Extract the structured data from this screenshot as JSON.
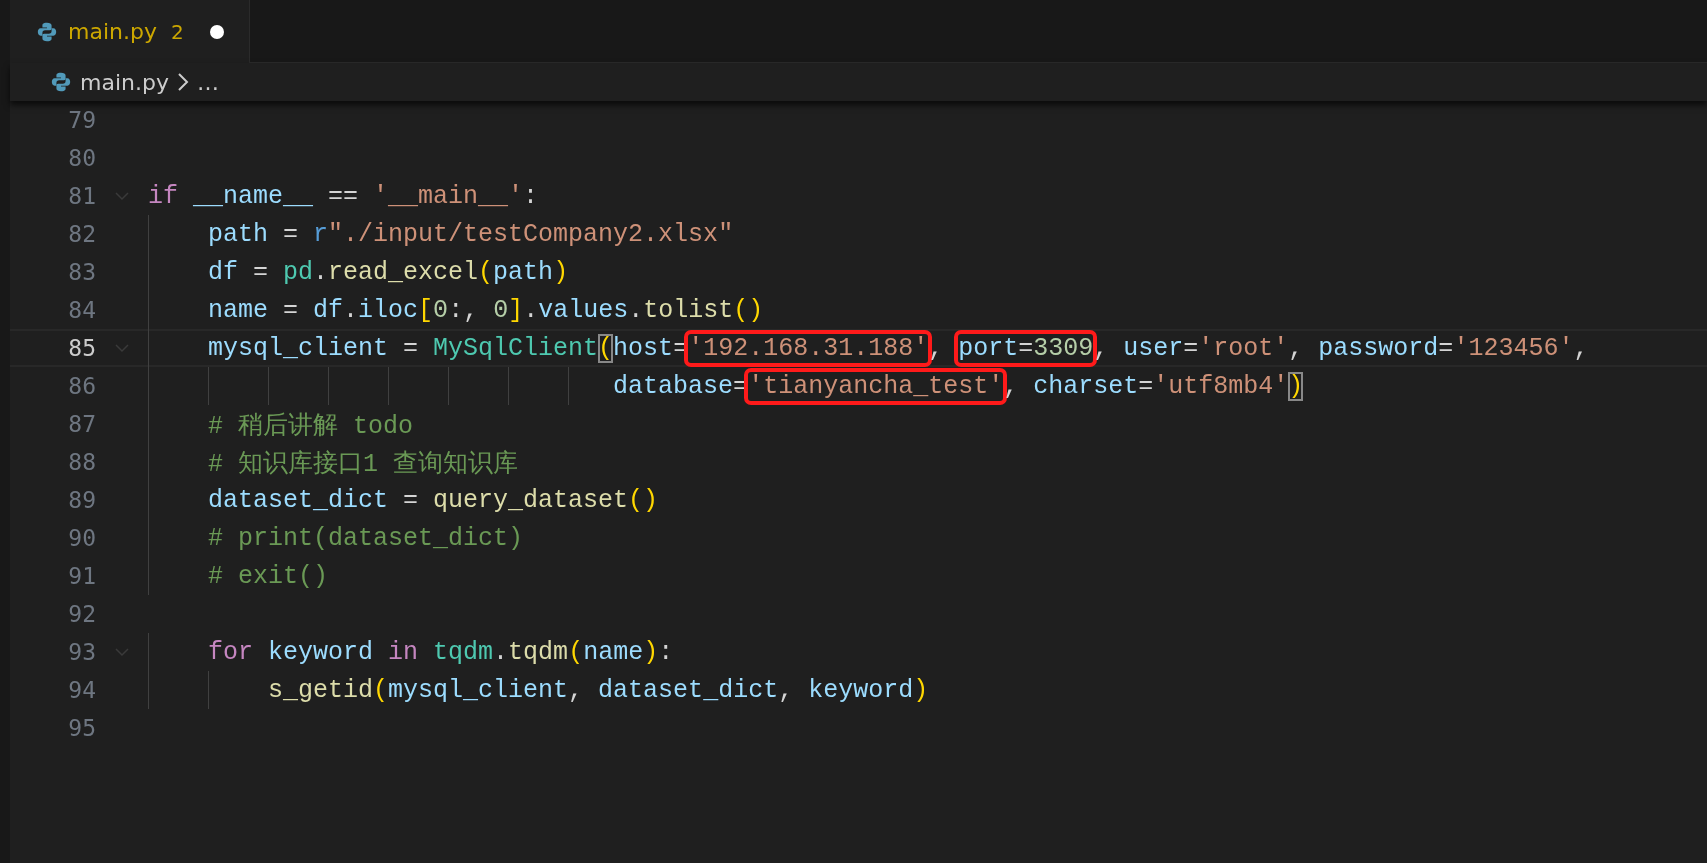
{
  "tabs": [
    {
      "label": "main.py",
      "problems": "2",
      "modified": true,
      "selected": true
    }
  ],
  "breadcrumb": {
    "file": "main.py",
    "more": "…"
  },
  "lines": [
    {
      "number": "79",
      "current": false,
      "foldable": false
    },
    {
      "number": "80",
      "current": false,
      "foldable": false
    },
    {
      "number": "81",
      "current": false,
      "foldable": true,
      "tokens": [
        {
          "kind": "keyword",
          "text": "if"
        },
        {
          "kind": "variable",
          "text": " __name__"
        },
        {
          "kind": "plain",
          "text": " == "
        },
        {
          "kind": "string",
          "text": "'__main__'"
        },
        {
          "kind": "plain",
          "text": ":"
        }
      ]
    },
    {
      "number": "82",
      "current": false,
      "foldable": false,
      "tokens": [
        {
          "kind": "variable",
          "text": "    path"
        },
        {
          "kind": "plain",
          "text": " = "
        },
        {
          "kind": "storage",
          "text": "r"
        },
        {
          "kind": "string",
          "text": "\"./input/testCompany2.xlsx\""
        }
      ]
    },
    {
      "number": "83",
      "current": false,
      "foldable": false,
      "tokens": [
        {
          "kind": "variable",
          "text": "    df"
        },
        {
          "kind": "plain",
          "text": " = "
        },
        {
          "kind": "class",
          "text": "pd"
        },
        {
          "kind": "plain",
          "text": "."
        },
        {
          "kind": "function",
          "text": "read_excel"
        },
        {
          "kind": "bracket",
          "text": "("
        },
        {
          "kind": "variable",
          "text": "path"
        },
        {
          "kind": "bracket",
          "text": ")"
        }
      ]
    },
    {
      "number": "84",
      "current": false,
      "foldable": false,
      "tokens": [
        {
          "kind": "variable",
          "text": "    name"
        },
        {
          "kind": "plain",
          "text": " = "
        },
        {
          "kind": "variable",
          "text": "df"
        },
        {
          "kind": "plain",
          "text": "."
        },
        {
          "kind": "variable",
          "text": "iloc"
        },
        {
          "kind": "bracket",
          "text": "["
        },
        {
          "kind": "number",
          "text": "0"
        },
        {
          "kind": "plain",
          "text": ":, "
        },
        {
          "kind": "number",
          "text": "0"
        },
        {
          "kind": "bracket",
          "text": "]"
        },
        {
          "kind": "plain",
          "text": "."
        },
        {
          "kind": "variable",
          "text": "values"
        },
        {
          "kind": "plain",
          "text": "."
        },
        {
          "kind": "function",
          "text": "tolist"
        },
        {
          "kind": "bracket",
          "text": "()"
        }
      ]
    },
    {
      "number": "85",
      "current": true,
      "foldable": true,
      "tokens": [
        {
          "kind": "variable",
          "text": "    mysql_client"
        },
        {
          "kind": "plain",
          "text": " = "
        },
        {
          "kind": "class",
          "text": "MySqlClient"
        },
        {
          "kind": "bracket-match",
          "text": "("
        },
        {
          "kind": "variable",
          "text": "host"
        },
        {
          "kind": "plain",
          "text": "="
        },
        {
          "kind": "annotation",
          "tokens": [
            {
              "kind": "string",
              "text": "'192.168.31.188'"
            }
          ]
        },
        {
          "kind": "plain",
          "text": ", "
        },
        {
          "kind": "annotation",
          "tokens": [
            {
              "kind": "variable",
              "text": "port"
            },
            {
              "kind": "plain",
              "text": "="
            },
            {
              "kind": "number",
              "text": "3309"
            }
          ]
        },
        {
          "kind": "plain",
          "text": ", "
        },
        {
          "kind": "variable",
          "text": "user"
        },
        {
          "kind": "plain",
          "text": "="
        },
        {
          "kind": "string",
          "text": "'root'"
        },
        {
          "kind": "plain",
          "text": ", "
        },
        {
          "kind": "variable",
          "text": "password"
        },
        {
          "kind": "plain",
          "text": "="
        },
        {
          "kind": "string",
          "text": "'123456'"
        },
        {
          "kind": "plain",
          "text": ","
        }
      ]
    },
    {
      "number": "86",
      "current": false,
      "foldable": false,
      "tokens": [
        {
          "kind": "variable",
          "text": "                               database"
        },
        {
          "kind": "plain",
          "text": "="
        },
        {
          "kind": "annotation",
          "tokens": [
            {
              "kind": "string",
              "text": "'tianyancha_test'"
            }
          ]
        },
        {
          "kind": "plain",
          "text": ", "
        },
        {
          "kind": "variable",
          "text": "charset"
        },
        {
          "kind": "plain",
          "text": "="
        },
        {
          "kind": "string",
          "text": "'utf8mb4'"
        },
        {
          "kind": "bracket-match",
          "text": ")"
        }
      ]
    },
    {
      "number": "87",
      "current": false,
      "foldable": false,
      "tokens": [
        {
          "kind": "comment",
          "text": "    # 稍后讲解 todo"
        }
      ]
    },
    {
      "number": "88",
      "current": false,
      "foldable": false,
      "tokens": [
        {
          "kind": "comment",
          "text": "    # 知识库接口1 查询知识库"
        }
      ]
    },
    {
      "number": "89",
      "current": false,
      "foldable": false,
      "tokens": [
        {
          "kind": "variable",
          "text": "    dataset_dict"
        },
        {
          "kind": "plain",
          "text": " = "
        },
        {
          "kind": "function",
          "text": "query_dataset"
        },
        {
          "kind": "bracket",
          "text": "()"
        }
      ]
    },
    {
      "number": "90",
      "current": false,
      "foldable": false,
      "tokens": [
        {
          "kind": "comment",
          "text": "    # print(dataset_dict)"
        }
      ]
    },
    {
      "number": "91",
      "current": false,
      "foldable": false,
      "tokens": [
        {
          "kind": "comment",
          "text": "    # exit()"
        }
      ]
    },
    {
      "number": "92",
      "current": false,
      "foldable": false
    },
    {
      "number": "93",
      "current": false,
      "foldable": true,
      "tokens": [
        {
          "kind": "keyword",
          "text": "    for"
        },
        {
          "kind": "variable",
          "text": " keyword"
        },
        {
          "kind": "keyword",
          "text": " in"
        },
        {
          "kind": "class",
          "text": " tqdm"
        },
        {
          "kind": "plain",
          "text": "."
        },
        {
          "kind": "function",
          "text": "tqdm"
        },
        {
          "kind": "bracket",
          "text": "("
        },
        {
          "kind": "variable",
          "text": "name"
        },
        {
          "kind": "bracket",
          "text": ")"
        },
        {
          "kind": "plain",
          "text": ":"
        }
      ]
    },
    {
      "number": "94",
      "current": false,
      "foldable": false,
      "tokens": [
        {
          "kind": "function",
          "text": "        s_getid"
        },
        {
          "kind": "bracket",
          "text": "("
        },
        {
          "kind": "variable",
          "text": "mysql_client"
        },
        {
          "kind": "plain",
          "text": ", "
        },
        {
          "kind": "variable",
          "text": "dataset_dict"
        },
        {
          "kind": "plain",
          "text": ", "
        },
        {
          "kind": "variable",
          "text": "keyword"
        },
        {
          "kind": "bracket",
          "text": ")"
        }
      ]
    },
    {
      "number": "95",
      "current": false,
      "foldable": false
    }
  ]
}
